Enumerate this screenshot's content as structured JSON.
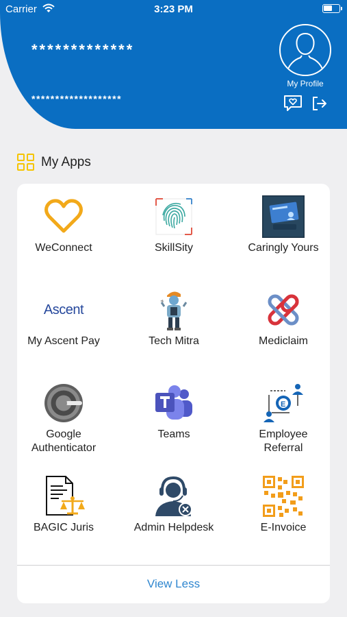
{
  "status_bar": {
    "carrier": "Carrier",
    "time": "3:23 PM"
  },
  "header": {
    "masked_name": "*************",
    "masked_id": "*******************",
    "profile_label": "My Profile"
  },
  "section": {
    "title": "My Apps"
  },
  "apps": [
    {
      "label": "WeConnect",
      "icon": "heart-icon"
    },
    {
      "label": "SkillSity",
      "icon": "fingerprint-icon"
    },
    {
      "label": "Caringly Yours",
      "icon": "caringly-yours-icon"
    },
    {
      "label": "My Ascent Pay",
      "icon": "ascent-logo-icon",
      "logo_text": "Ascent"
    },
    {
      "label": "Tech Mitra",
      "icon": "tech-mitra-icon"
    },
    {
      "label": "Mediclaim",
      "icon": "mediclaim-icon"
    },
    {
      "label": "Google\nAuthenticator",
      "icon": "google-authenticator-icon"
    },
    {
      "label": "Teams",
      "icon": "teams-icon"
    },
    {
      "label": "Employee\nReferral",
      "icon": "employee-referral-icon"
    },
    {
      "label": "BAGIC Juris",
      "icon": "legal-document-icon"
    },
    {
      "label": "Admin Helpdesk",
      "icon": "helpdesk-icon"
    },
    {
      "label": "E-Invoice",
      "icon": "qr-code-icon"
    }
  ],
  "footer": {
    "view_less": "View Less"
  },
  "colors": {
    "header_blue": "#0a6ec2",
    "accent_yellow": "#f5c400",
    "link_blue": "#2f86cf"
  }
}
